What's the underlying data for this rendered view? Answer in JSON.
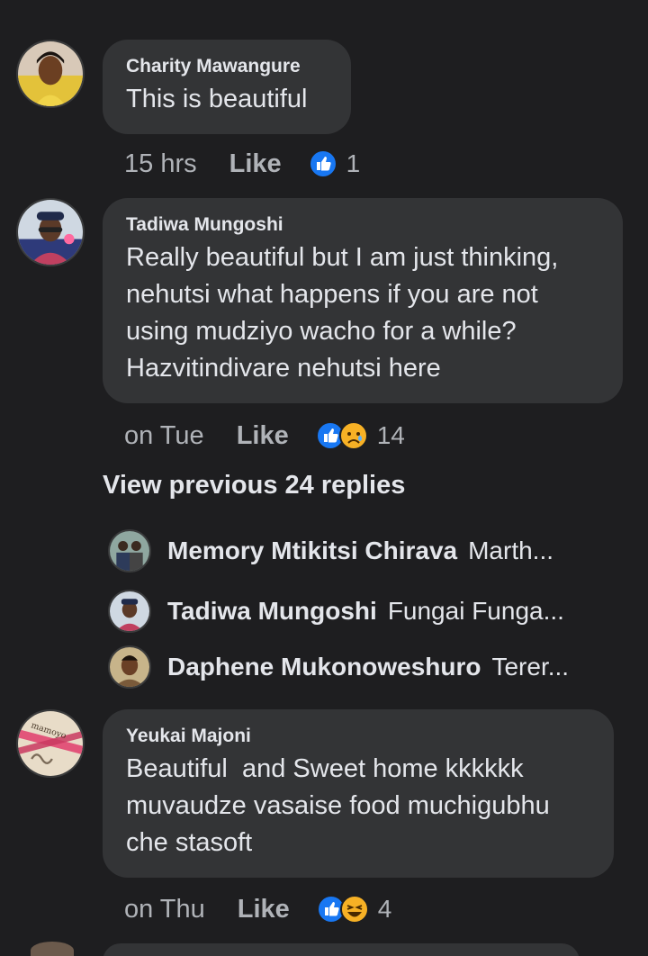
{
  "comments": [
    {
      "author": "Charity Mawangure",
      "text_lines": [
        "This is beautiful"
      ],
      "time": "15 hrs",
      "like_label": "Like",
      "reactions": [
        "like-icon"
      ],
      "reaction_count": "1"
    },
    {
      "author": "Tadiwa Mungoshi",
      "text_lines": [
        "Really beautiful but I am just thinking,",
        "nehutsi what happens if you are not",
        "using mudziyo wacho for a while?",
        "Hazvitindivare nehutsi here"
      ],
      "time": "on Tue",
      "like_label": "Like",
      "reactions": [
        "like-icon",
        "sad-icon"
      ],
      "reaction_count": "14"
    },
    {
      "author": "Yeukai Majoni",
      "text_lines": [
        "Beautiful  and Sweet home kkkkkk",
        "muvaudze vasaise food muchigubhu",
        "che stasoft"
      ],
      "time": "on Thu",
      "like_label": "Like",
      "reactions": [
        "like-icon",
        "haha-icon"
      ],
      "reaction_count": "4"
    }
  ],
  "view_previous": "View previous 24 replies",
  "replies": [
    {
      "name": "Memory Mtikitsi Chirava",
      "snippet": "Marth..."
    },
    {
      "name": "Tadiwa Mungoshi",
      "snippet": "Fungai Funga..."
    },
    {
      "name": "Daphene Mukonoweshuro",
      "snippet": "Terer..."
    }
  ],
  "avatar_badge_text": "mamoyo",
  "colors": {
    "background": "#1e1e20",
    "bubble": "#333436",
    "text": "#e4e6eb",
    "meta": "#b0b3b8",
    "like_blue": "#1877f2",
    "emoji_yellow": "#f7b125"
  }
}
